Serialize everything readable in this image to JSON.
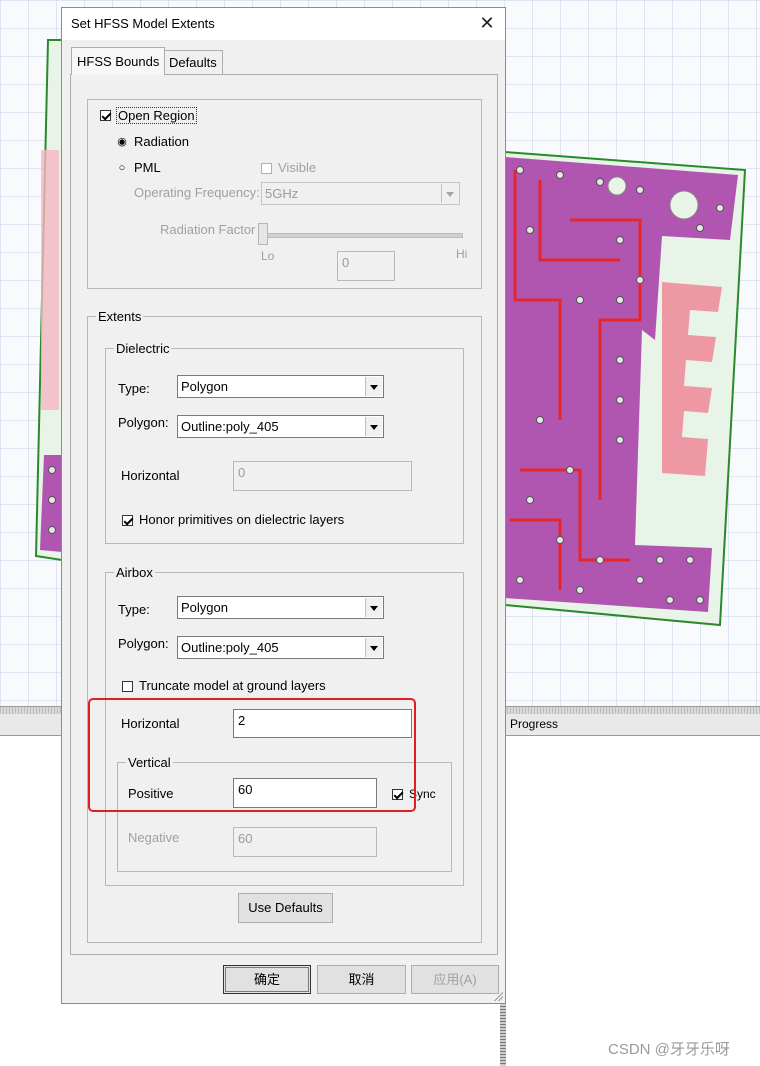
{
  "dialog": {
    "title": "Set HFSS Model Extents",
    "tabs": [
      {
        "label": "HFSS Bounds"
      },
      {
        "label": "Defaults"
      }
    ]
  },
  "open_region": {
    "label": "Open Region",
    "checked": true,
    "radiation_label": "Radiation",
    "pml_label": "PML",
    "visible_label": "Visible",
    "operating_frequency_label": "Operating Frequency:",
    "operating_frequency_value": "5GHz",
    "radiation_factor_label": "Radiation Factor",
    "slider_lo": "Lo",
    "slider_hi": "Hi",
    "radiation_factor_value": "0"
  },
  "extents": {
    "label": "Extents",
    "dielectric": {
      "label": "Dielectric",
      "type_label": "Type:",
      "type_value": "Polygon",
      "polygon_label": "Polygon:",
      "polygon_value": "Outline:poly_405",
      "horizontal_label": "Horizontal",
      "horizontal_value": "0",
      "honor_label": "Honor primitives on dielectric layers"
    },
    "airbox": {
      "label": "Airbox",
      "type_label": "Type:",
      "type_value": "Polygon",
      "polygon_label": "Polygon:",
      "polygon_value": "Outline:poly_405",
      "truncate_label": "Truncate model at ground layers",
      "horizontal_label": "Horizontal",
      "horizontal_value": "2",
      "vertical": {
        "label": "Vertical",
        "positive_label": "Positive",
        "positive_value": "60",
        "sync_label": "Sync",
        "negative_label": "Negative",
        "negative_value": "60"
      }
    },
    "use_defaults_label": "Use Defaults"
  },
  "footer": {
    "ok_label": "确定",
    "cancel_label": "取消",
    "apply_label": "应用(A)"
  },
  "background": {
    "progress_label": "Progress",
    "watermark": "CSDN @牙牙乐呀"
  },
  "colors": {
    "highlight": "#e02020",
    "board_fill": "#a63aa6",
    "trace": "#e8262a"
  }
}
